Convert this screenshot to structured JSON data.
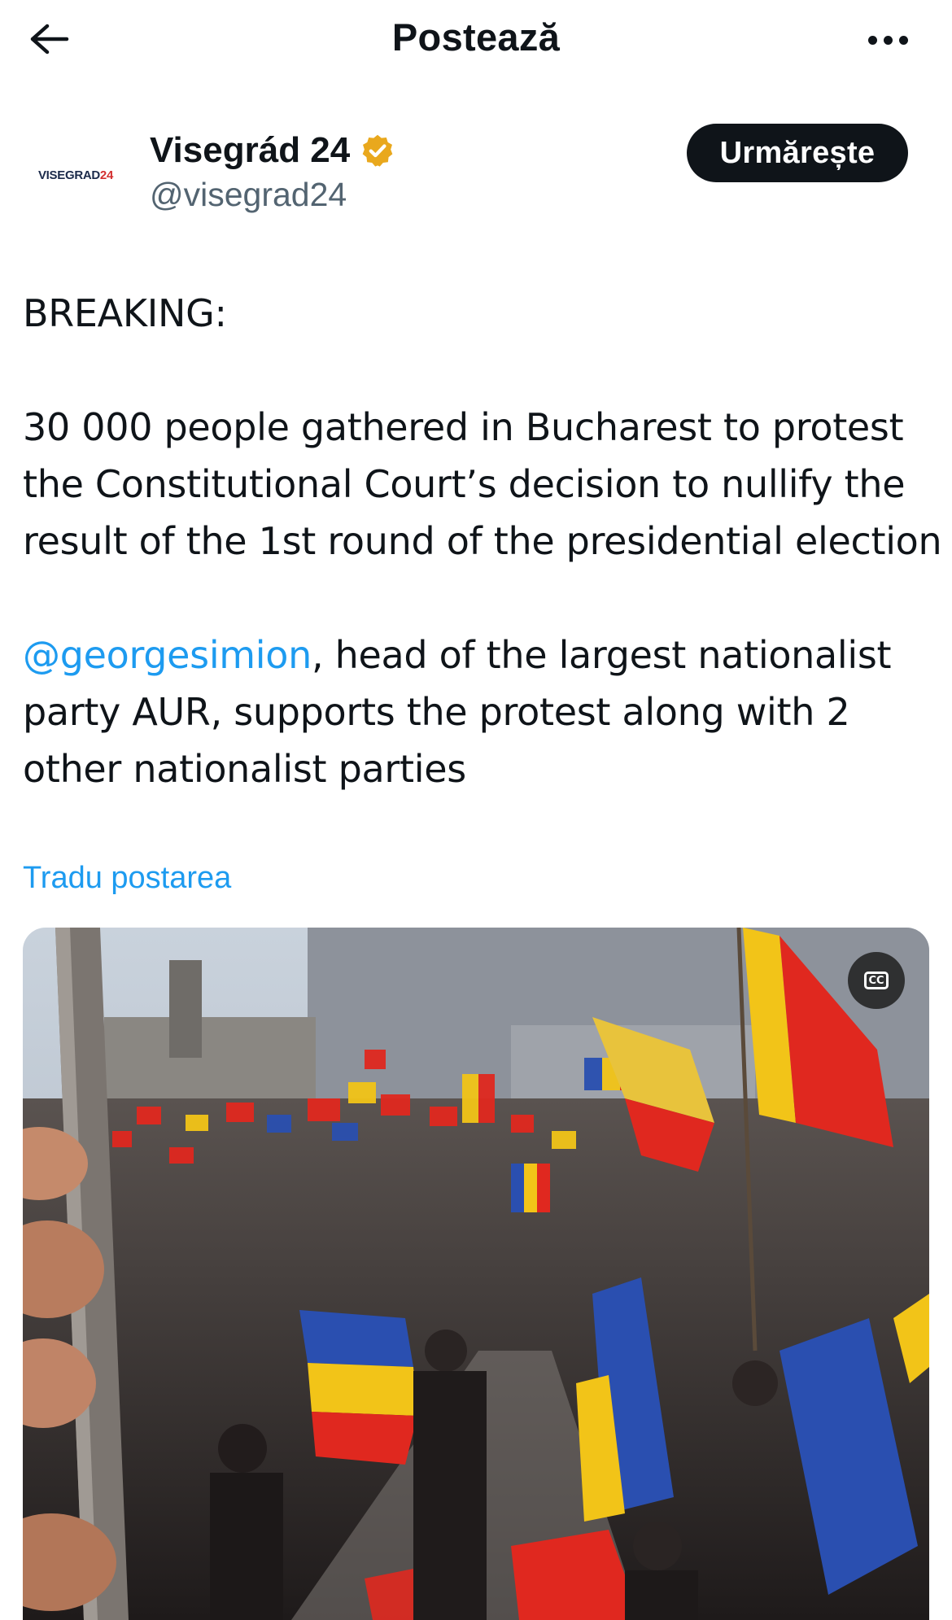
{
  "header": {
    "title": "Postează",
    "back_icon": "arrow-left-icon",
    "more_icon": "more-horizontal-icon"
  },
  "author": {
    "name": "Visegrád 24",
    "handle": "@visegrad24",
    "verified": true,
    "verified_color": "#e9a81d",
    "avatar_logo_main": "VISEGRAD",
    "avatar_logo_accent": "24",
    "follow_label": "Urmărește"
  },
  "post": {
    "paragraph1": "BREAKING:",
    "paragraph2_lines": [
      "30 000 people gathered in Bucharest to protest",
      "the Constitutional Court’s decision to nullify the",
      "result of the 1st round of the presidential election"
    ],
    "mention": "@georgesimion",
    "paragraph3_line1_rest": ", head of the largest nationalist",
    "paragraph3_lines_rest": [
      "party AUR, supports the protest along with 2",
      "other nationalist parties"
    ],
    "translate_label": "Tradu postarea"
  },
  "media": {
    "type": "video",
    "captions_icon": "closed-captions-icon",
    "captions_label": "CC"
  },
  "colors": {
    "accent": "#1d9bf0",
    "text": "#0f1419",
    "secondary_text": "#536471",
    "flag_blue": "#2a4fb0",
    "flag_yellow": "#f2c418",
    "flag_red": "#e0281f"
  }
}
